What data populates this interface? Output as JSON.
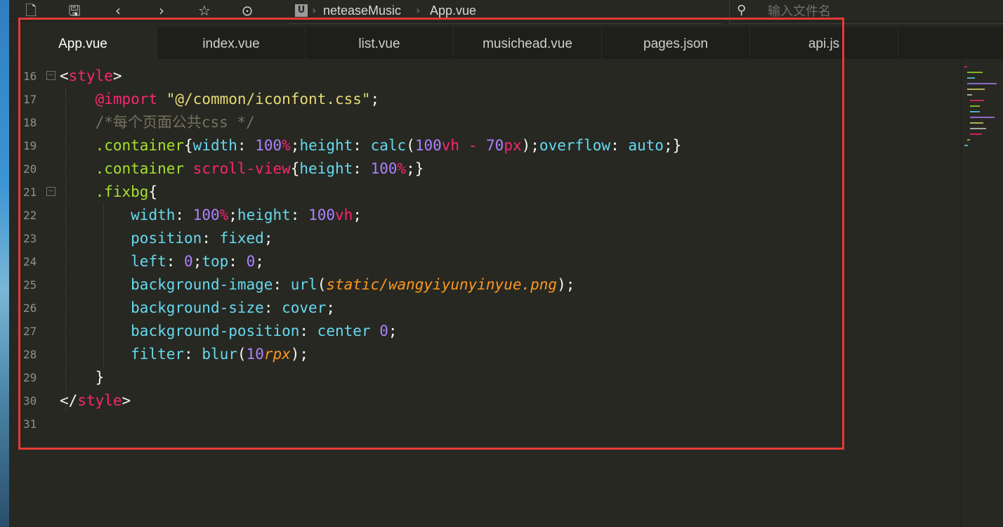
{
  "toolbar": {
    "icons": [
      "new-file-icon",
      "save-icon",
      "back-icon",
      "forward-icon",
      "star-icon",
      "run-icon"
    ]
  },
  "breadcrumb": {
    "project_badge": "U",
    "project": "neteaseMusic",
    "file": "App.vue"
  },
  "search": {
    "placeholder": "输入文件名"
  },
  "tabs": [
    {
      "label": "App.vue",
      "active": true
    },
    {
      "label": "index.vue",
      "active": false
    },
    {
      "label": "list.vue",
      "active": false
    },
    {
      "label": "musichead.vue",
      "active": false
    },
    {
      "label": "pages.json",
      "active": false
    },
    {
      "label": "api.js",
      "active": false
    }
  ],
  "editor": {
    "lines": [
      {
        "n": "16",
        "text": "<style>"
      },
      {
        "n": "17",
        "text": "    @import \"@/common/iconfont.css\";"
      },
      {
        "n": "18",
        "text": "    /*每个页面公共css */"
      },
      {
        "n": "19",
        "text": "    .container{width: 100%;height: calc(100vh - 70px);overflow: auto;}"
      },
      {
        "n": "20",
        "text": "    .container scroll-view{height: 100%;}"
      },
      {
        "n": "21",
        "text": "    .fixbg{"
      },
      {
        "n": "22",
        "text": "        width: 100%;height: 100vh;"
      },
      {
        "n": "23",
        "text": "        position: fixed;"
      },
      {
        "n": "24",
        "text": "        left: 0;top: 0;"
      },
      {
        "n": "25",
        "text": "        background-image: url(static/wangyiyunyinyue.png);"
      },
      {
        "n": "26",
        "text": "        background-size: cover;"
      },
      {
        "n": "27",
        "text": "        background-position: center 0;"
      },
      {
        "n": "28",
        "text": "        filter: blur(10rpx);"
      },
      {
        "n": "29",
        "text": "    }"
      },
      {
        "n": "30",
        "text": "</style>"
      },
      {
        "n": "31",
        "text": ""
      }
    ]
  },
  "colors": {
    "background": "#272822",
    "tag": "#f92672",
    "string": "#e6db74",
    "comment": "#75715e",
    "selector": "#a6e22e",
    "property": "#66d9ef",
    "number": "#ae81ff",
    "highlight_border": "#e53935"
  }
}
